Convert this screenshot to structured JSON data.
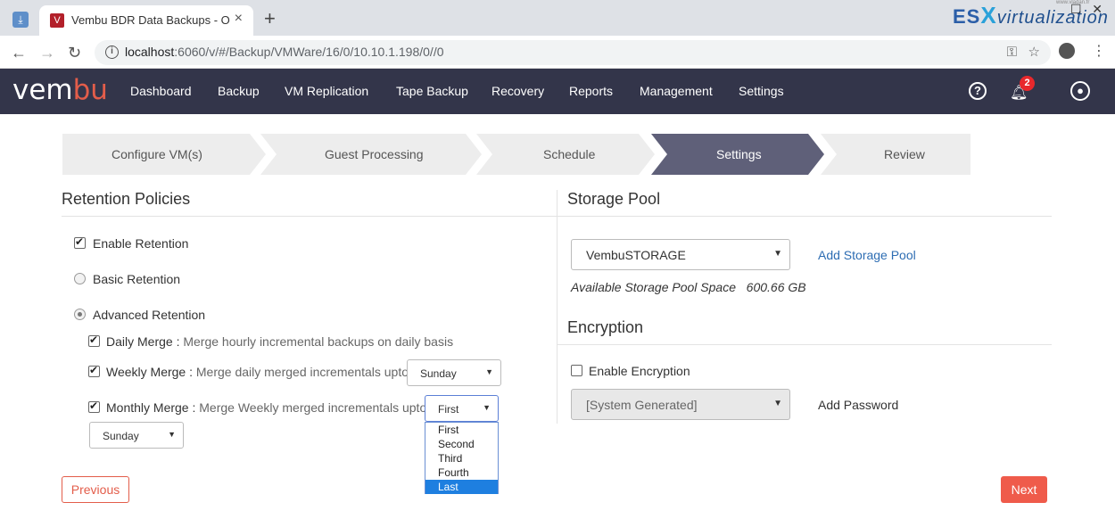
{
  "browser": {
    "tab_title": "Vembu BDR Data Backups - Onli",
    "tab_favicon": "V",
    "url_host": "localhost",
    "url_path": ":6060/v/#/Backup/VMWare/16/0/10.10.1.198/0//0",
    "watermark_esx": "ES",
    "watermark_x": "X",
    "watermark_virt": "virtualization",
    "watermark_site": "www.vladan.fr"
  },
  "app": {
    "brand_a": "vem",
    "brand_b": "bu",
    "nav": [
      "Dashboard",
      "Backup",
      "VM Replication",
      "Tape Backup",
      "Recovery",
      "Reports",
      "Management",
      "Settings"
    ],
    "notification_count": "2",
    "accent_color": "#e35d4a"
  },
  "wizard": {
    "steps": [
      "Configure VM(s)",
      "Guest Processing",
      "Schedule",
      "Settings",
      "Review"
    ],
    "active_step": "Settings"
  },
  "retention": {
    "title": "Retention Policies",
    "enable_label": "Enable Retention",
    "enable_checked": true,
    "basic_label": "Basic Retention",
    "advanced_label": "Advanced Retention",
    "selected_mode": "Advanced Retention",
    "daily": {
      "title": "Daily Merge :",
      "desc": " Merge hourly incremental backups on daily basis",
      "checked": true
    },
    "weekly": {
      "title": "Weekly Merge :",
      "desc": " Merge daily merged incrementals upto",
      "checked": true,
      "day": "Sunday"
    },
    "monthly": {
      "title": "Monthly Merge :",
      "desc": " Merge Weekly merged incrementals upto",
      "checked": true,
      "week": "First",
      "day": "Sunday"
    },
    "week_options": [
      "First",
      "Second",
      "Third",
      "Fourth",
      "Last"
    ],
    "highlighted_option": "Last"
  },
  "storage": {
    "title": "Storage Pool",
    "pool": "VembuSTORAGE",
    "add_pool": "Add Storage Pool",
    "avail_label": "Available Storage Pool Space",
    "avail_value": "600.66 GB"
  },
  "encryption": {
    "title": "Encryption",
    "enable_label": "Enable Encryption",
    "enable_checked": false,
    "key": "[System Generated]",
    "add_password": "Add Password"
  },
  "footer": {
    "previous": "Previous",
    "next": "Next"
  }
}
